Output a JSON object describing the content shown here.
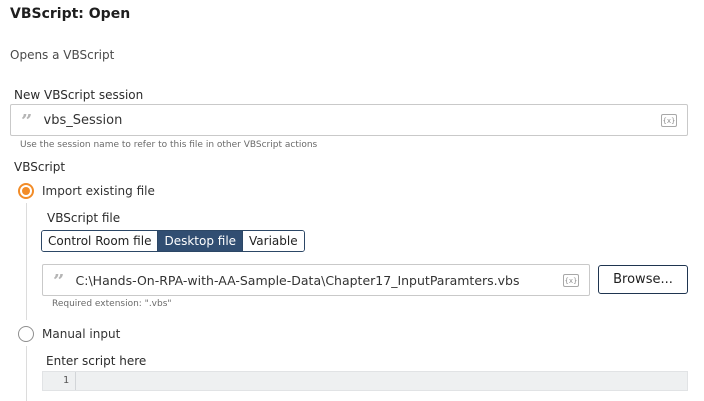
{
  "header": {
    "title": "VBScript: Open",
    "description": "Opens a VBScript"
  },
  "session": {
    "label": "New VBScript session",
    "value": "vbs_Session",
    "help": "Use the session name to refer to this file in other VBScript actions",
    "quote_icon": "”",
    "var_icon": "{x}"
  },
  "vbscript": {
    "label": "VBScript",
    "option_import": "Import existing file",
    "option_manual": "Manual input",
    "selected": "Import existing file"
  },
  "file": {
    "label": "VBScript file",
    "tabs": [
      "Control Room file",
      "Desktop file",
      "Variable"
    ],
    "active_tab": "Desktop file",
    "path": "C:\\Hands-On-RPA-with-AA-Sample-Data\\Chapter17_InputParamters.vbs",
    "help": "Required extension: \".vbs\"",
    "browse_label": "Browse...",
    "quote_icon": "”",
    "var_icon": "{x}"
  },
  "manual": {
    "label": "Enter script here",
    "line_number": "1"
  },
  "colors": {
    "accent_orange": "#f28c28",
    "segment_active": "#314e72",
    "segment_border": "#2c4766"
  }
}
